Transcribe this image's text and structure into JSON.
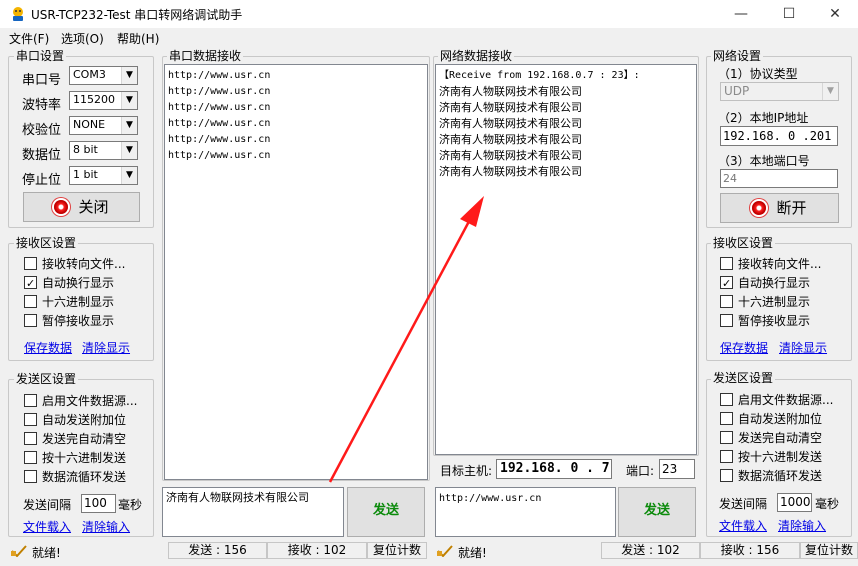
{
  "window": {
    "title": "USR-TCP232-Test 串口转网络调试助手",
    "minimize_icon": "minimize-icon",
    "maximize_icon": "maximize-icon",
    "close_icon": "close-icon"
  },
  "menu": [
    "文件(F)",
    "选项(O)",
    "帮助(H)"
  ],
  "serial_settings": {
    "title": "串口设置",
    "fields": [
      {
        "label": "串口号",
        "value": "COM3"
      },
      {
        "label": "波特率",
        "value": "115200"
      },
      {
        "label": "校验位",
        "value": "NONE"
      },
      {
        "label": "数据位",
        "value": "8 bit"
      },
      {
        "label": "停止位",
        "value": "1 bit"
      }
    ],
    "toggle_button": "关闭"
  },
  "serial_receive": {
    "title": "串口数据接收",
    "lines": [
      "http://www.usr.cn",
      "http://www.usr.cn",
      "http://www.usr.cn",
      "http://www.usr.cn",
      "http://www.usr.cn",
      "http://www.usr.cn"
    ]
  },
  "net_receive": {
    "title": "网络数据接收",
    "header": "【Receive from 192.168.0.7 : 23】:",
    "lines": [
      "济南有人物联网技术有限公司",
      "济南有人物联网技术有限公司",
      "济南有人物联网技术有限公司",
      "济南有人物联网技术有限公司",
      "济南有人物联网技术有限公司",
      "济南有人物联网技术有限公司"
    ]
  },
  "net_settings": {
    "title": "网络设置",
    "protocol_label": "（1）协议类型",
    "protocol_value": "UDP",
    "ip_label": "（2）本地IP地址",
    "ip_value": "192.168. 0 .201",
    "port_label": "（3）本地端口号",
    "port_value": "24",
    "toggle_button": "断开"
  },
  "left_receive_settings": {
    "title": "接收区设置",
    "options": [
      {
        "label": "接收转向文件...",
        "checked": false
      },
      {
        "label": "自动换行显示",
        "checked": true
      },
      {
        "label": "十六进制显示",
        "checked": false
      },
      {
        "label": "暂停接收显示",
        "checked": false
      }
    ],
    "save_link": "保存数据",
    "clear_link": "清除显示"
  },
  "right_receive_settings": {
    "title": "接收区设置",
    "options": [
      {
        "label": "接收转向文件...",
        "checked": false
      },
      {
        "label": "自动换行显示",
        "checked": true
      },
      {
        "label": "十六进制显示",
        "checked": false
      },
      {
        "label": "暂停接收显示",
        "checked": false
      }
    ],
    "save_link": "保存数据",
    "clear_link": "清除显示"
  },
  "left_send_settings": {
    "title": "发送区设置",
    "options": [
      {
        "label": "启用文件数据源...",
        "checked": false
      },
      {
        "label": "自动发送附加位",
        "checked": false
      },
      {
        "label": "发送完自动清空",
        "checked": false
      },
      {
        "label": "按十六进制发送",
        "checked": false
      },
      {
        "label": "数据流循环发送",
        "checked": false
      }
    ],
    "interval_label": "发送间隔",
    "interval_value": "100",
    "interval_unit": "毫秒",
    "load_link": "文件载入",
    "clear_link": "清除输入"
  },
  "right_send_settings": {
    "title": "发送区设置",
    "options": [
      {
        "label": "启用文件数据源...",
        "checked": false
      },
      {
        "label": "自动发送附加位",
        "checked": false
      },
      {
        "label": "发送完自动清空",
        "checked": false
      },
      {
        "label": "按十六进制发送",
        "checked": false
      },
      {
        "label": "数据流循环发送",
        "checked": false
      }
    ],
    "interval_label": "发送间隔",
    "interval_value": "1000",
    "interval_unit": "毫秒",
    "load_link": "文件载入",
    "clear_link": "清除输入"
  },
  "target": {
    "host_label": "目标主机:",
    "host_value": "192.168. 0 . 7",
    "port_label": "端口:",
    "port_value": "23"
  },
  "serial_send": {
    "text": "济南有人物联网技术有限公司",
    "button": "发送"
  },
  "net_send": {
    "text": "http://www.usr.cn",
    "button": "发送"
  },
  "status_left": {
    "ready": "就绪!",
    "sent": "发送 : 156",
    "recv": "接收 : 102",
    "reset": "复位计数"
  },
  "status_right": {
    "ready": "就绪!",
    "sent": "发送 : 102",
    "recv": "接收 : 156",
    "reset": "复位计数"
  },
  "annotation": {
    "color": "#ff1a1a"
  }
}
